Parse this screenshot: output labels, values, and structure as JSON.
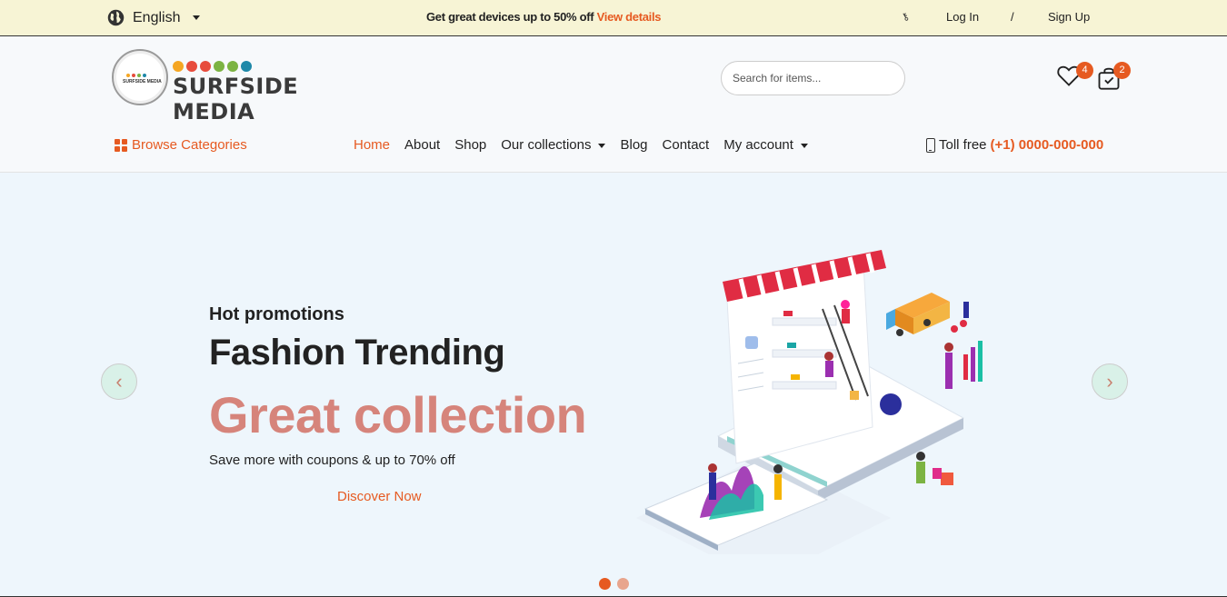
{
  "topbar": {
    "language": "English",
    "promo_text": "Get great devices up to 50% off",
    "promo_link": "View details",
    "login": "Log In",
    "separator": "/",
    "signup": "Sign Up"
  },
  "header": {
    "logo_text": "SURFSIDE MEDIA",
    "logo_small_text": "SURFSIDE MEDIA",
    "logo_dot_colors": [
      "#f5a623",
      "#e74c3c",
      "#e74c3c",
      "#7cb342",
      "#7cb342",
      "#1e88a8"
    ],
    "search_placeholder": "Search for items...",
    "wishlist_count": "4",
    "cart_count": "2"
  },
  "nav": {
    "browse_categories": "Browse Categories",
    "items": [
      "Home",
      "About",
      "Shop",
      "Our collections",
      "Blog",
      "Contact",
      "My account"
    ],
    "toll_free_label": "Toll free",
    "toll_free_number": "(+1) 0000-000-000"
  },
  "hero": {
    "kicker": "Hot promotions",
    "title": "Fashion Trending",
    "headline": "Great collection",
    "subtitle": "Save more with coupons & up to 70% off",
    "cta": "Discover Now",
    "prev_arrow": "‹",
    "next_arrow": "›"
  },
  "colors": {
    "accent": "#e65a21",
    "headline": "#d6847b",
    "topbar_bg": "#f7f4d5",
    "hero_bg": "#eef6fc"
  }
}
